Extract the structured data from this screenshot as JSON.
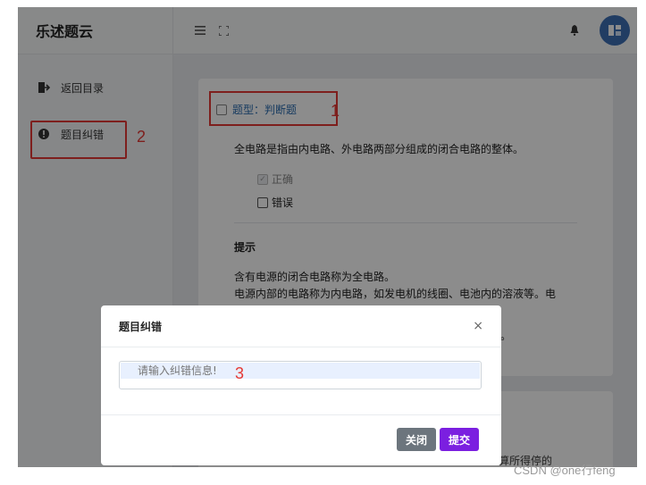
{
  "app": {
    "brand": "乐述题云"
  },
  "sidebar": {
    "items": [
      {
        "label": "返回目录",
        "icon": "exit-door-icon"
      },
      {
        "label": "题目纠错",
        "icon": "alert-circle-icon"
      }
    ]
  },
  "topbar": {
    "icons": [
      "menu-icon",
      "fullscreen-icon",
      "bell-icon",
      "avatar"
    ]
  },
  "question": {
    "type_label": "题型：判断题",
    "stem": "全电路是指由内电路、外电路两部分组成的闭合电路的整体。",
    "options": [
      {
        "label": "正确",
        "checked": true
      },
      {
        "label": "错误",
        "checked": false
      }
    ],
    "hint_title": "提示",
    "hint_lines": [
      "含有电源的闭合电路称为全电路。",
      "电源内部的电路称为内电路，如发电机的线圈、电池内的溶液等。电"
    ],
    "hint_partial": "阻。"
  },
  "modal": {
    "title": "题目纠错",
    "close_glyph": "×",
    "input_placeholder": "请输入纠错信息!",
    "close_button": "关闭",
    "submit_button": "提交"
  },
  "behind_partial": "算所得停的",
  "annotations": {
    "one": "1",
    "two": "2",
    "three": "3"
  },
  "watermark": "CSDN @one行feng",
  "colors": {
    "annotation": "#e53935",
    "submit": "#7b1fe0",
    "close_btn": "#6c757d",
    "link": "#2b6cb0"
  }
}
